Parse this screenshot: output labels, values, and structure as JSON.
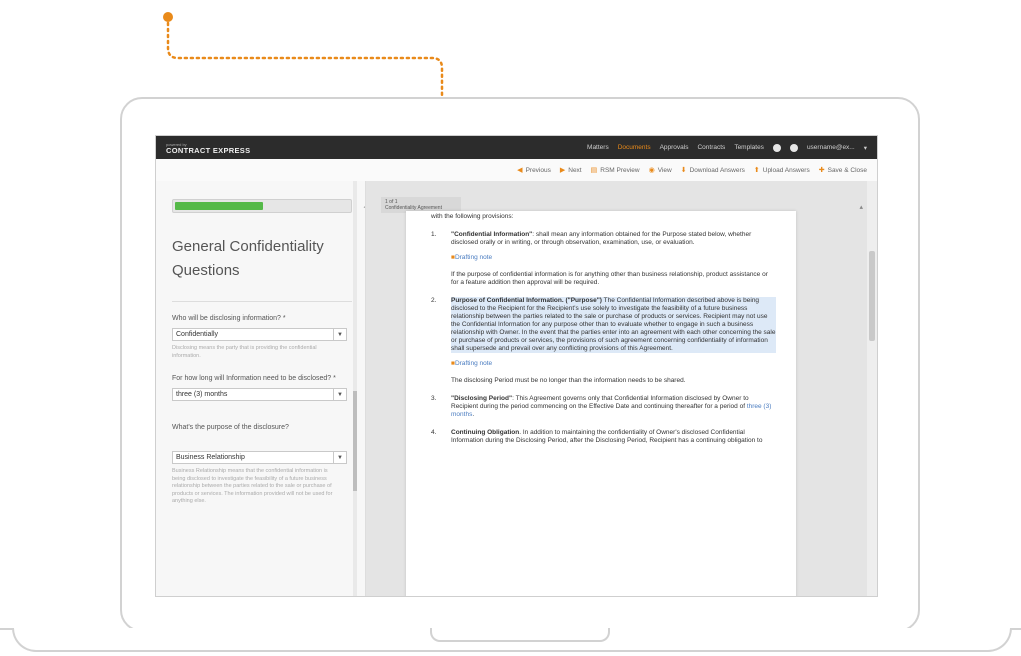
{
  "colors": {
    "accent": "#e98a1a",
    "progress": "#55b948",
    "topbar": "#2c2c2c",
    "link": "#4a7cc0"
  },
  "app": {
    "brand_small": "powered by",
    "brand_name": "CONTRACT EXPRESS",
    "nav": [
      "Matters",
      "Documents",
      "Approvals",
      "Contracts",
      "Templates"
    ],
    "active_nav_index": 1,
    "user": "username@ex..."
  },
  "toolbar": {
    "items": [
      {
        "icon": "previous-icon",
        "label": "Previous"
      },
      {
        "icon": "next-icon",
        "label": "Next"
      },
      {
        "icon": "preview-icon",
        "label": "RSM Preview"
      },
      {
        "icon": "view-icon",
        "label": "View"
      },
      {
        "icon": "download-icon",
        "label": "Download Answers"
      },
      {
        "icon": "upload-icon",
        "label": "Upload Answers"
      },
      {
        "icon": "save-icon",
        "label": "Save & Close"
      }
    ]
  },
  "progress": {
    "fraction": 0.5
  },
  "section": {
    "title": "General Confidentiality Questions"
  },
  "questions": [
    {
      "label": "Who will be disclosing information? *",
      "value": "Confidentially",
      "help": "Disclosing means the party that is providing the confidential information."
    },
    {
      "label": "For how long will Information need to be disclosed? *",
      "value": "three (3) months",
      "help": ""
    },
    {
      "label": "What's the purpose of the disclosure?",
      "value": "Business Relationship",
      "help": "Business Relationship means that the confidential information is being disclosed to investigate the feasibility of a future business relationship between the parties related to the sale or purchase of products or services. The information provided will not be used for anything else."
    }
  ],
  "document": {
    "tab_label": "1 of 1",
    "tab_sub": "Confidentiality Agreement",
    "intro": "with the following provisions:",
    "clause1_num": "1.",
    "clause1_head": "\"Confidential Information\"",
    "clause1_text": ": shall mean any information obtained for the Purpose stated below, whether disclosed orally or in writing, or through observation, examination, use, or evaluation.",
    "note1": "Drafting note",
    "note1_text": "If the purpose of confidential information is for anything other than business relationship, product assistance or for a feature addition then approval will be required.",
    "clause2_num": "2.",
    "clause2_head": "Purpose of Confidential Information",
    "clause2_term": ". (\"Purpose\")",
    "clause2_text": " The Confidential Information described above is being disclosed to the Recipient for the Recipient's use solely to investigate the feasibility of a future business relationship between the parties related to the sale or purchase of products or services. Recipient may not use the Confidential Information for any purpose other than to evaluate whether to engage in such a business relationship with Owner. In the event that the parties enter into an agreement with each other concerning the sale or purchase of products or services, the provisions of such agreement concerning confidentiality of information shall supersede and prevail over any conflicting provisions of this Agreement.",
    "note2": "Drafting note",
    "note2_text": "The disclosing Period must be no longer than the information needs to be shared.",
    "clause3_num": "3.",
    "clause3_head": "\"Disclosing Period\"",
    "clause3_text": ": This Agreement governs only that Confidential Information disclosed by Owner to Recipient during the period commencing on the Effective Date and continuing thereafter for a period of ",
    "clause3_period": "three (3) months",
    "clause4_num": "4.",
    "clause4_head": "Continuing Obligation",
    "clause4_text": ". In addition to maintaining the confidentiality of Owner's disclosed Confidential Information during the Disclosing Period, after the Disclosing Period, Recipient has a continuing obligation to"
  }
}
